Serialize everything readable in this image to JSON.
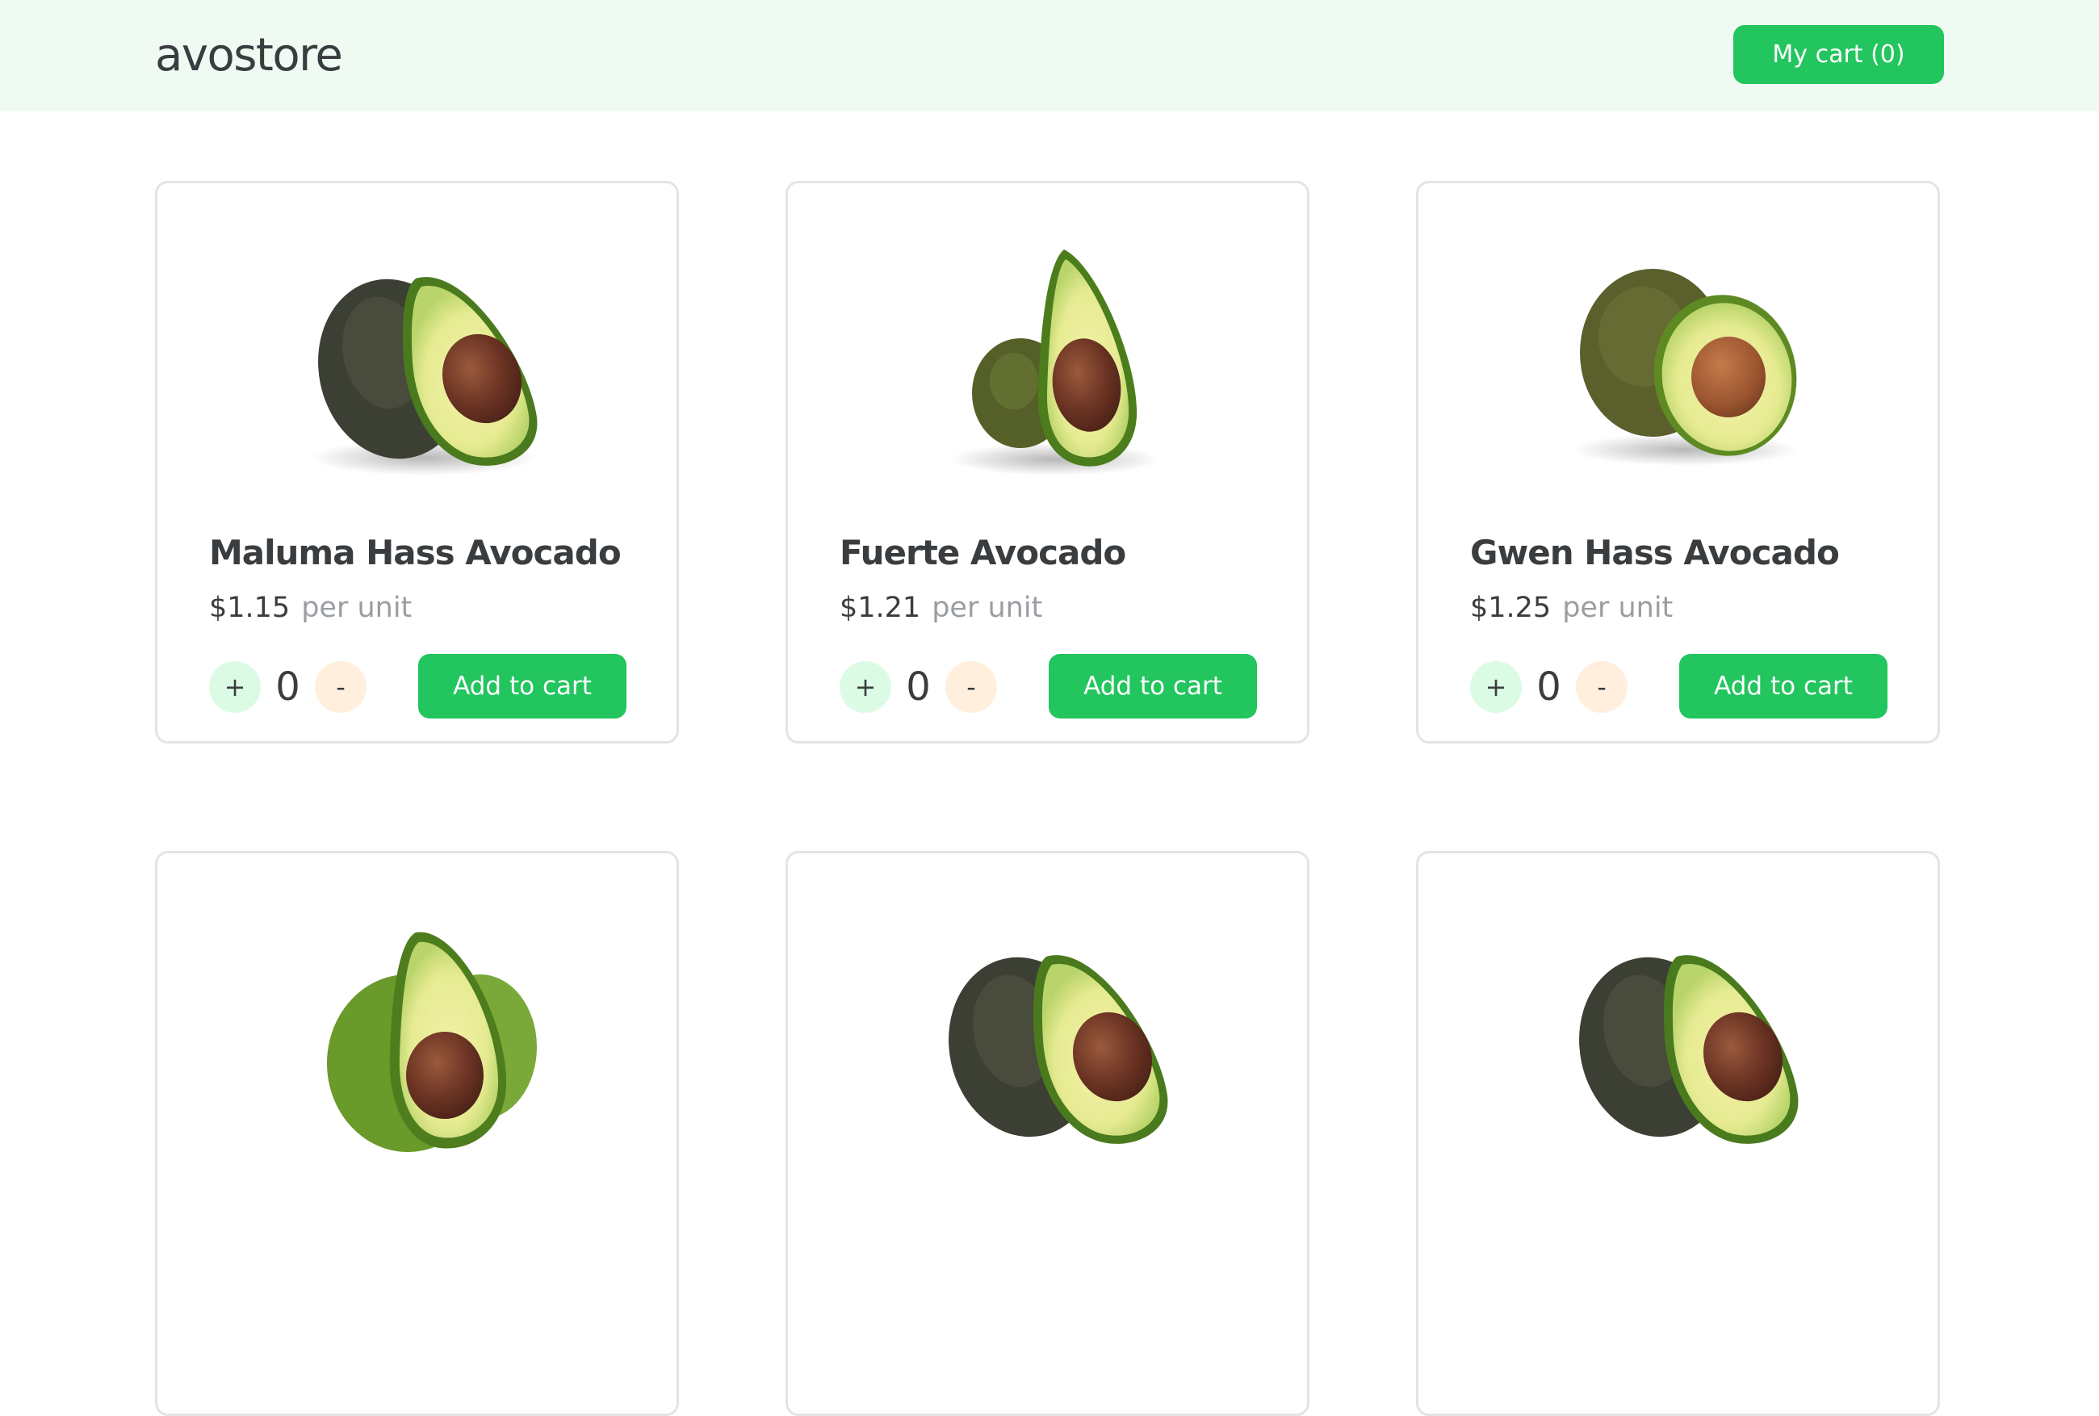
{
  "header": {
    "logo": "avostore",
    "cart_label": "My cart (0)"
  },
  "colors": {
    "accent": "#22c55e",
    "header_bg": "#effbf2",
    "plus_bg": "#dcfbe5",
    "minus_bg": "#ffefdc"
  },
  "products": [
    {
      "name": "Maluma Hass Avocado",
      "price": "$1.15",
      "unit": "per unit",
      "qty": "0",
      "plus": "+",
      "minus": "-",
      "add_label": "Add to cart",
      "image": "halved-hass-avocado"
    },
    {
      "name": "Fuerte Avocado",
      "price": "$1.21",
      "unit": "per unit",
      "qty": "0",
      "plus": "+",
      "minus": "-",
      "add_label": "Add to cart",
      "image": "halved-fuerte-avocado"
    },
    {
      "name": "Gwen Hass Avocado",
      "price": "$1.25",
      "unit": "per unit",
      "qty": "0",
      "plus": "+",
      "minus": "-",
      "add_label": "Add to cart",
      "image": "halved-gwen-avocado"
    },
    {
      "image": "halved-green-avocado"
    },
    {
      "image": "halved-hass-avocado"
    },
    {
      "image": "halved-hass-avocado"
    }
  ]
}
